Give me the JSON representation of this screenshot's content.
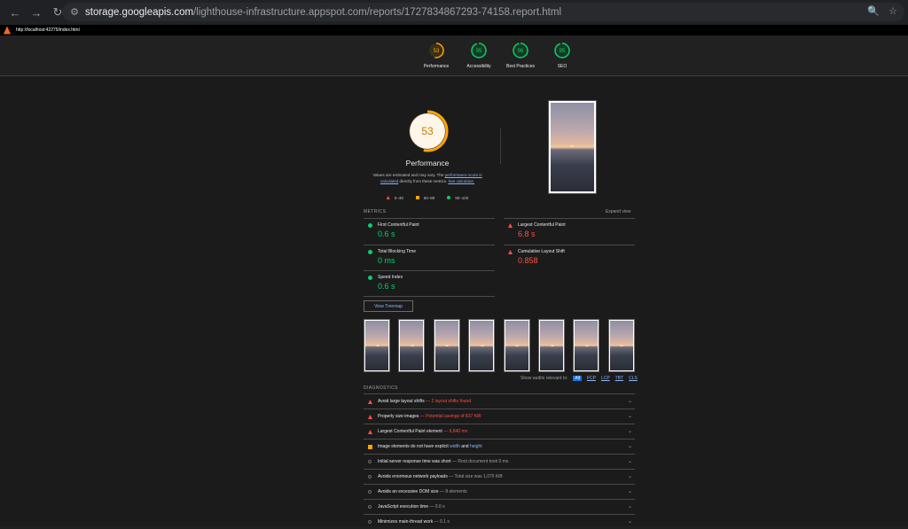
{
  "browser": {
    "url_host": "storage.googleapis.com",
    "url_path": "/lighthouse-infrastructure.appspot.com/reports/1727834867293-74158.report.html",
    "back_icon": "←",
    "forward_icon": "→",
    "reload_icon": "↻",
    "site_icon": "⚙",
    "zoom_icon": "🔍",
    "star_icon": "☆"
  },
  "page_url": "http://localhost:42275/index.html",
  "gauges": [
    {
      "label": "Performance",
      "score": "53",
      "color": "#ffa400",
      "bg": "#3a2f1a",
      "fraction": 0.53
    },
    {
      "label": "Accessibility",
      "score": "95",
      "color": "#0cce6b",
      "bg": "#163a24",
      "fraction": 0.95
    },
    {
      "label": "Best Practices",
      "score": "96",
      "color": "#0cce6b",
      "bg": "#163a24",
      "fraction": 0.96
    },
    {
      "label": "SEO",
      "score": "95",
      "color": "#0cce6b",
      "bg": "#163a24",
      "fraction": 0.95
    }
  ],
  "hero": {
    "score": "53",
    "title": "Performance",
    "desc_pre": "Values are estimated and may vary. The ",
    "desc_link1": "performance score is calculated",
    "desc_mid": " directly from these metrics. ",
    "desc_link2": "See calculator.",
    "legend": [
      "0–49",
      "50–89",
      "90–100"
    ]
  },
  "metrics": {
    "heading": "METRICS",
    "expand": "Expand view",
    "items": [
      {
        "title": "First Contentful Paint",
        "value": "0.6 s",
        "status": "good"
      },
      {
        "title": "Largest Contentful Paint",
        "value": "6.8 s",
        "status": "bad"
      },
      {
        "title": "Total Blocking Time",
        "value": "0 ms",
        "status": "good"
      },
      {
        "title": "Cumulative Layout Shift",
        "value": "0.858",
        "status": "bad"
      },
      {
        "title": "Speed Index",
        "value": "0.6 s",
        "status": "good"
      }
    ]
  },
  "treemap_label": "View Treemap",
  "show_audits": {
    "label": "Show audits relevant to:",
    "chips": [
      "All",
      "FCP",
      "LCP",
      "TBT",
      "CLS"
    ]
  },
  "diagnostics": {
    "heading": "DIAGNOSTICS",
    "items": [
      {
        "title": "Avoid large layout shifts",
        "display": "— 2 layout shifts found",
        "status": "bad"
      },
      {
        "title": "Properly size images",
        "display": "— Potential savings of 837 KiB",
        "status": "bad"
      },
      {
        "title": "Largest Contentful Paint element",
        "display": "— 6,840 ms",
        "status": "bad"
      },
      {
        "title": "Image elements do not have explicit",
        "code1": "width",
        "and": "and",
        "code2": "height",
        "status": "avg"
      },
      {
        "title": "Initial server response time was short",
        "display": "— Root document took 0 ms",
        "status": "pass"
      },
      {
        "title": "Avoids enormous network payloads",
        "display": "— Total size was 1,075 KiB",
        "status": "pass"
      },
      {
        "title": "Avoids an excessive DOM size",
        "display": "— 8 elements",
        "status": "pass"
      },
      {
        "title": "JavaScript execution time",
        "display": "— 0.0 s",
        "status": "pass"
      },
      {
        "title": "Minimizes main-thread work",
        "display": "— 0.1 s",
        "status": "pass"
      }
    ]
  }
}
